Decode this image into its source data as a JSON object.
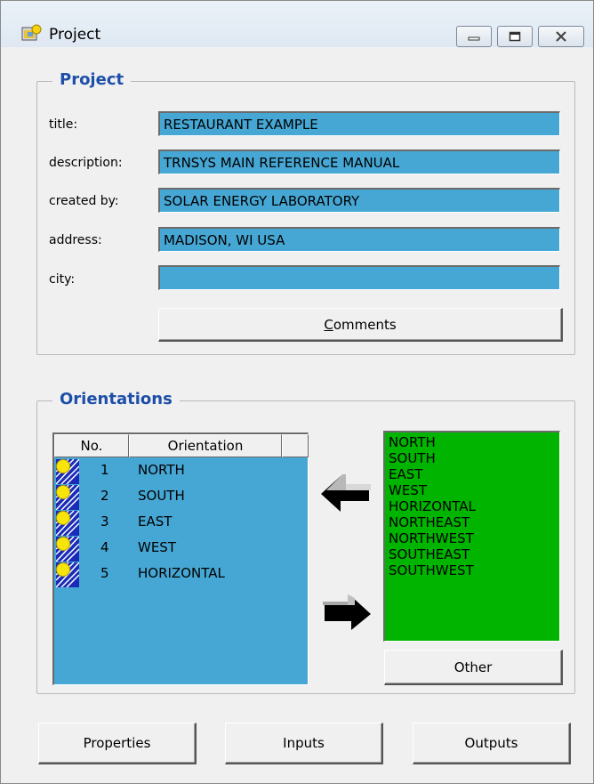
{
  "window": {
    "title": "Project"
  },
  "project_group": {
    "title": "Project",
    "fields": [
      {
        "label": "title:",
        "value": "RESTAURANT EXAMPLE"
      },
      {
        "label": "description:",
        "value": "TRNSYS MAIN REFERENCE MANUAL"
      },
      {
        "label": "created by:",
        "value": "SOLAR ENERGY LABORATORY"
      },
      {
        "label": "address:",
        "value": "MADISON, WI  USA"
      },
      {
        "label": "city:",
        "value": ""
      }
    ],
    "comments_button": {
      "mnemonic": "C",
      "rest": "omments"
    }
  },
  "orientations_group": {
    "title": "Orientations",
    "columns": [
      "No.",
      "Orientation"
    ],
    "rows": [
      {
        "no": "1",
        "name": "NORTH"
      },
      {
        "no": "2",
        "name": "SOUTH"
      },
      {
        "no": "3",
        "name": "EAST"
      },
      {
        "no": "4",
        "name": "WEST"
      },
      {
        "no": "5",
        "name": "HORIZONTAL"
      }
    ],
    "available": [
      "NORTH",
      "SOUTH",
      "EAST",
      "WEST",
      "HORIZONTAL",
      "NORTHEAST",
      "NORTHWEST",
      "SOUTHEAST",
      "SOUTHWEST"
    ],
    "other_button": "Other"
  },
  "bottom_buttons": {
    "properties": "Properties",
    "inputs": "Inputs",
    "outputs": "Outputs"
  },
  "colors": {
    "field_bg": "#46a7d4",
    "available_bg": "#00b400",
    "group_title": "#1e4fa8"
  },
  "icons": [
    "app-icon",
    "minimize-icon",
    "maximize-icon",
    "close-icon",
    "sun-icon",
    "arrow-left-icon",
    "arrow-right-icon"
  ]
}
